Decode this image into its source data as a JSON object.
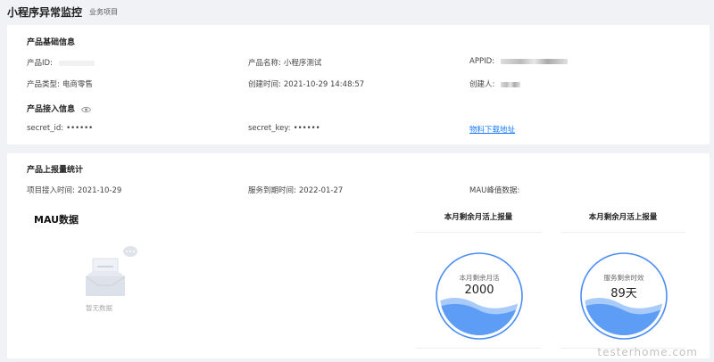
{
  "header": {
    "title": "小程序异常监控",
    "tag": "业务项目"
  },
  "basic": {
    "section_title": "产品基础信息",
    "product_id_label": "产品ID:",
    "product_name_label": "产品名称:",
    "product_name_value": "小程序测试",
    "appid_label": "APPID:",
    "product_type_label": "产品类型:",
    "product_type_value": "电商零售",
    "created_time_label": "创建时间:",
    "created_time_value": "2021-10-29 14:48:57",
    "creator_label": "创建人:"
  },
  "access": {
    "section_title": "产品接入信息",
    "secret_id_label": "secret_id:",
    "secret_id_value": "••••••",
    "secret_key_label": "secret_key:",
    "secret_key_value": "••••••",
    "download_link": "物料下载地址"
  },
  "report": {
    "section_title": "产品上报量统计",
    "access_time_label": "项目接入时间:",
    "access_time_value": "2021-10-29",
    "expire_time_label": "服务到期时间:",
    "expire_time_value": "2022-01-27",
    "mau_peak_label": "MAU峰值数据:",
    "mau_title": "MAU数据",
    "empty_text": "暂无数据"
  },
  "stats": [
    {
      "title": "本月剩余月活上报量",
      "gauge_label": "本月剩余月活",
      "gauge_value": "2000"
    },
    {
      "title": "本月剩余月活上报量",
      "gauge_label": "服务剩余时效",
      "gauge_value": "89天"
    }
  ],
  "watermark": "testerhome.com"
}
